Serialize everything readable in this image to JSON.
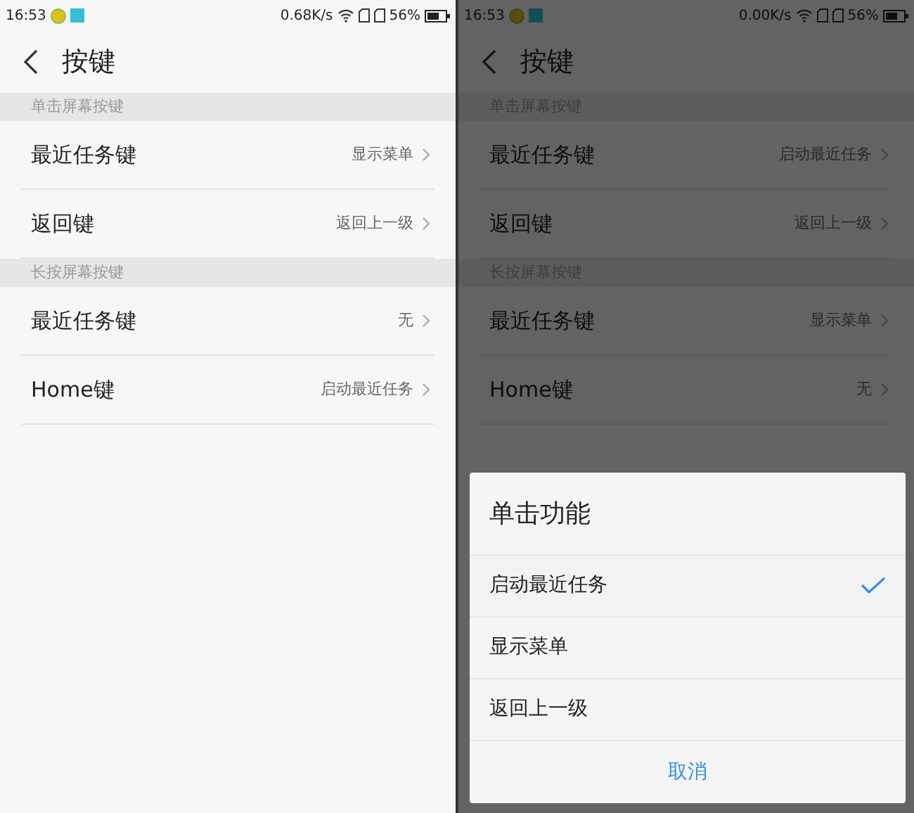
{
  "screens": [
    {
      "status_bar": {
        "time": "16:53",
        "speed": "0.68K/s",
        "battery": "56%"
      },
      "title": "按键",
      "dimmed": false,
      "sections": [
        {
          "header": "单击屏幕按键",
          "items": [
            {
              "label": "最近任务键",
              "value": "显示菜单"
            },
            {
              "label": "返回键",
              "value": "返回上一级"
            }
          ]
        },
        {
          "header": "长按屏幕按键",
          "items": [
            {
              "label": "最近任务键",
              "value": "无"
            },
            {
              "label": "Home键",
              "value": "启动最近任务"
            }
          ]
        }
      ]
    },
    {
      "status_bar": {
        "time": "16:53",
        "speed": "0.00K/s",
        "battery": "56%"
      },
      "title": "按键",
      "dimmed": true,
      "sections": [
        {
          "header": "单击屏幕按键",
          "items": [
            {
              "label": "最近任务键",
              "value": "启动最近任务"
            },
            {
              "label": "返回键",
              "value": "返回上一级"
            }
          ]
        },
        {
          "header": "长按屏幕按键",
          "items": [
            {
              "label": "最近任务键",
              "value": "显示菜单"
            },
            {
              "label": "Home键",
              "value": "无"
            }
          ]
        }
      ],
      "dialog": {
        "title": "单击功能",
        "options": [
          {
            "label": "启动最近任务",
            "selected": true
          },
          {
            "label": "显示菜单",
            "selected": false
          },
          {
            "label": "返回上一级",
            "selected": false
          }
        ],
        "cancel": "取消"
      }
    }
  ]
}
